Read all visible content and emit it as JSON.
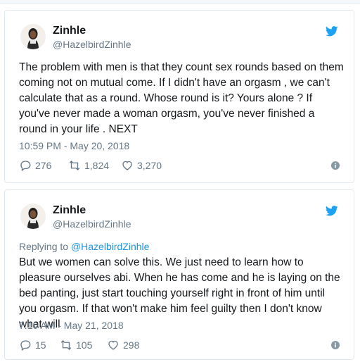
{
  "tweets": [
    {
      "author": {
        "name": "Zinhle",
        "handle": "@HazelbirdZinhle"
      },
      "text": "The problem with men is that they count sex rounds based on them coming not on mutual come. If I didn't have an orgasm , we can't calculate that as a round. Whose round is it? Yours alone ? If you've never made a woman orgasm, you've never finished a round in your life . NEXT",
      "timestamp": "10:59 PM - May 20, 2018",
      "stats": {
        "replies": "276",
        "retweets": "1,824",
        "likes": "3,270"
      }
    },
    {
      "author": {
        "name": "Zinhle",
        "handle": "@HazelbirdZinhle"
      },
      "replying_prefix": "Replying to",
      "replying_to": "@HazelbirdZinhle",
      "text": "But we women can solve this. We just need to learn how to pleasure ourselves abi. When he has come and he is laying on the bed panting, just start touching yourself right in front of him until you orgasm. If that won't make him feel guilty then I don't know what will",
      "timestamp": "7:10 AM - May 21, 2018",
      "stats": {
        "replies": "15",
        "retweets": "105",
        "likes": "298"
      }
    }
  ],
  "colors": {
    "twitter_blue": "#1da1f2",
    "gray": "#657786",
    "text": "#14171a",
    "link": "#1b95e0"
  },
  "icons": [
    "twitter-bird-icon",
    "reply-icon",
    "retweet-icon",
    "like-icon",
    "info-icon"
  ]
}
